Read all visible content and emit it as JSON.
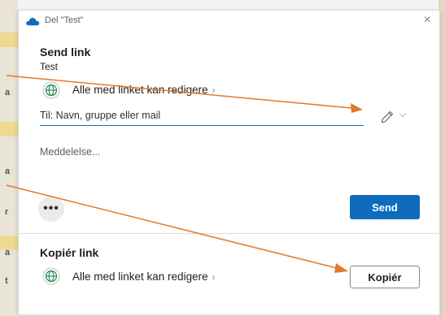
{
  "dialog": {
    "title": "Del \"Test\"",
    "close_label": "×"
  },
  "send_section": {
    "title": "Send link",
    "item_name": "Test",
    "permission_label": "Alle med linket kan redigere",
    "permission_chevron": "›",
    "to_placeholder": "Til: Navn, gruppe eller mail",
    "pencil_chevron": "⌵",
    "message_placeholder": "Meddelelse...",
    "more_label": "•••",
    "send_label": "Send"
  },
  "copy_section": {
    "title": "Kopiér link",
    "permission_label": "Alle med linket kan redigere",
    "permission_chevron": "›",
    "copy_label": "Kopiér"
  },
  "background": {
    "left_letters": [
      "a",
      "a",
      "r",
      "a",
      "t"
    ]
  },
  "colors": {
    "accent": "#0f6cbd",
    "arrow": "#e07a2e",
    "globe": "#2e8b57"
  },
  "icons": [
    "onedrive-cloud-icon",
    "close-icon",
    "globe-icon",
    "pencil-icon",
    "chevron-down-icon",
    "more-icon"
  ]
}
